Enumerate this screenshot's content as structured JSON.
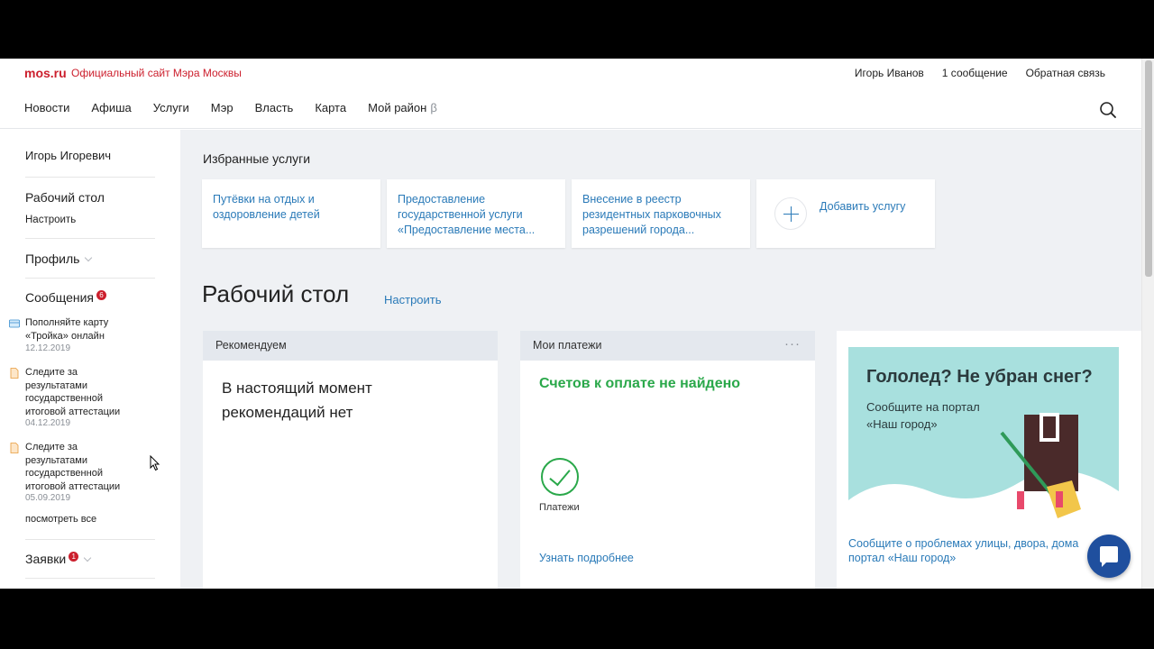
{
  "header": {
    "logo": "mos.ru",
    "site_title": "Официальный сайт Мэра Москвы",
    "user_name": "Игорь Иванов",
    "messages_link": "1 сообщение",
    "feedback_link": "Обратная связь",
    "nav": [
      "Новости",
      "Афиша",
      "Услуги",
      "Мэр",
      "Власть",
      "Карта",
      "Мой район"
    ],
    "nav_beta": "β",
    "search_icon": "search-icon"
  },
  "sidebar": {
    "user": "Игорь Игоревич",
    "desktop_title": "Рабочий стол",
    "desktop_setup": "Настроить",
    "profile": "Профиль",
    "messages_title": "Сообщения",
    "messages_count": "6",
    "messages": [
      {
        "text": "Пополняйте карту «Тройка» онлайн",
        "date": "12.12.2019",
        "icon": "card-icon"
      },
      {
        "text": "Следите за результатами государственной итоговой аттестации",
        "date": "04.12.2019",
        "icon": "document-icon"
      },
      {
        "text": "Следите за результатами государственной итоговой аттестации",
        "date": "05.09.2019",
        "icon": "document-icon"
      }
    ],
    "see_all": "посмотреть все",
    "requests_title": "Заявки",
    "requests_count": "1"
  },
  "main": {
    "favorites_title": "Избранные услуги",
    "favorites": [
      "Путёвки на отдых и оздоровление детей",
      "Предоставление государственной услуги «Предоставление места...",
      "Внесение в реестр резидентных парковочных разрешений города..."
    ],
    "add_service": "Добавить услугу",
    "workspace_title": "Рабочий стол",
    "workspace_setup": "Настроить",
    "recommend": {
      "header": "Рекомендуем",
      "text": "В настоящий момент рекомендаций нет"
    },
    "payments": {
      "header": "Мои платежи",
      "menu": "···",
      "status": "Счетов к оплате не найдено",
      "icon_label": "Платежи",
      "more": "Узнать подробнее"
    },
    "promo": {
      "title": "Гололед? Не убран снег?",
      "subtitle": "Сообщите на портал «Наш город»",
      "link": "Сообщите о проблемах улицы, двора, дома портал «Наш город»"
    }
  },
  "colors": {
    "brand_red": "#cc1f2d",
    "link_blue": "#2a7ab8",
    "success_green": "#2aa84a",
    "chat_blue": "#1f4f9e"
  }
}
